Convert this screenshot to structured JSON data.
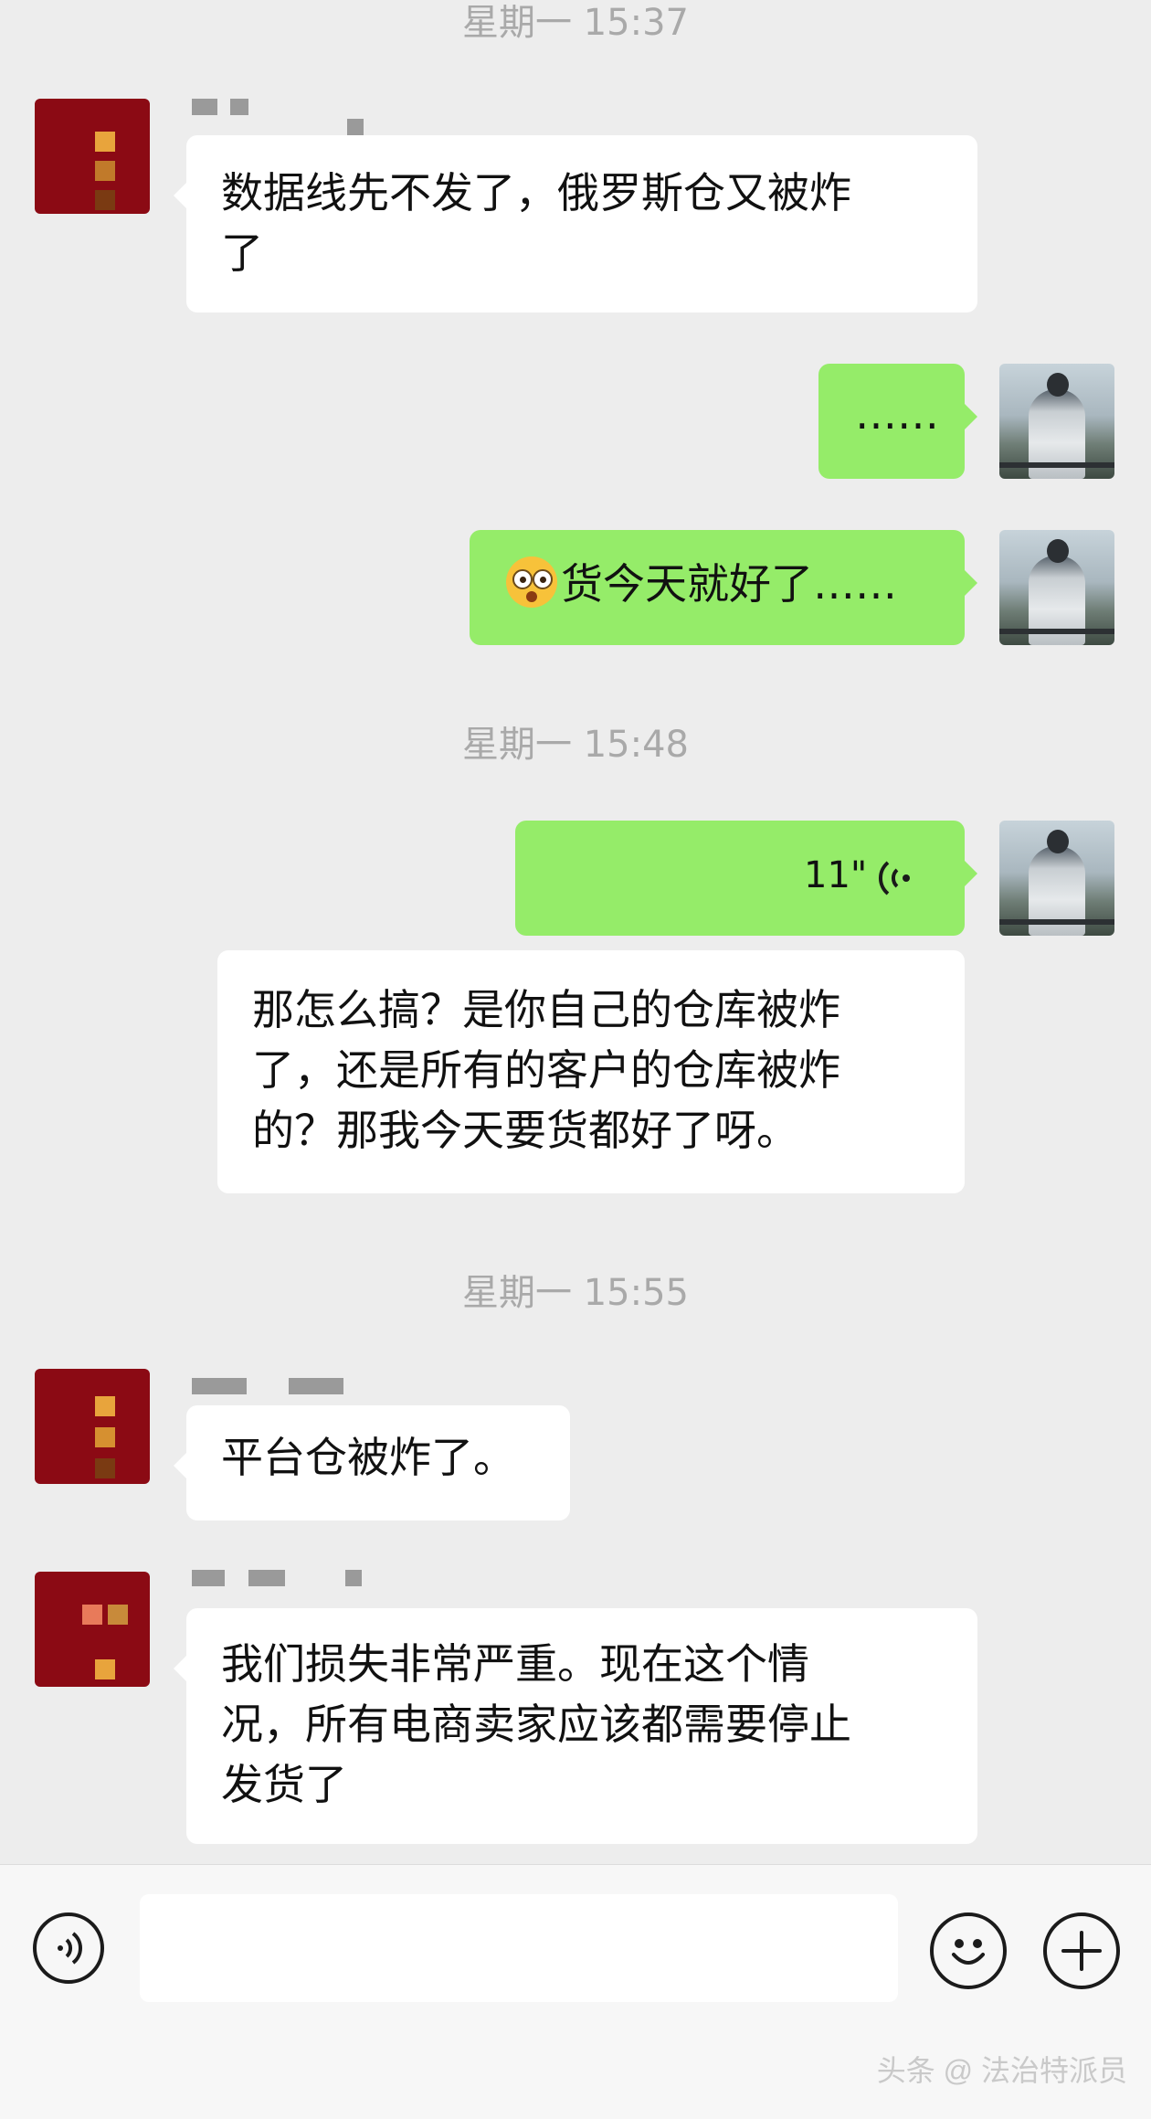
{
  "timestamps": [
    "星期一 15:37",
    "星期一 15:48",
    "星期一 15:55"
  ],
  "messages": [
    {
      "side": "left",
      "text_lines": [
        "数据线先不发了，俄罗斯仓又被炸",
        "了"
      ]
    },
    {
      "side": "right",
      "text": "……"
    },
    {
      "side": "right",
      "emoji": "flushed-face-emoji",
      "text": "货今天就好了……"
    },
    {
      "side": "right",
      "type": "voice",
      "duration": "11\""
    },
    {
      "side": "right-white",
      "text_lines": [
        "那怎么搞？是你自己的仓库被炸",
        "了，还是所有的客户的仓库被炸",
        "的？那我今天要货都好了呀。"
      ]
    },
    {
      "side": "left",
      "text": "平台仓被炸了。"
    },
    {
      "side": "left",
      "text_lines": [
        "我们损失非常严重。现在这个情",
        "况，所有电商卖家应该都需要停止",
        "发货了"
      ]
    }
  ],
  "input_bar": {
    "voice_icon": "voice-input-icon",
    "emoji_icon": "smiley-face-icon",
    "plus_icon": "plus-icon",
    "input_value": ""
  },
  "watermark": "头条 @ 法治特派员"
}
